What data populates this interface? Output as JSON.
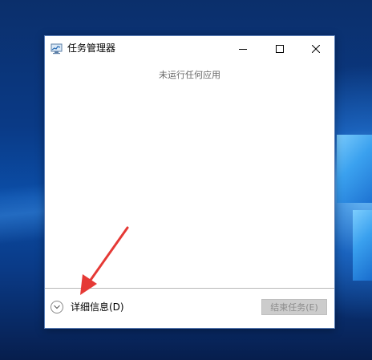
{
  "window": {
    "title": "任务管理器",
    "status_text": "未运行任何应用",
    "details_label": "详细信息(D)",
    "end_task_label": "结束任务(E)"
  },
  "icons": {
    "app": "task-manager-icon",
    "minimize": "minimize-icon",
    "maximize": "maximize-icon",
    "close": "close-icon",
    "details": "chevron-down-circle-icon"
  },
  "colors": {
    "annotation_arrow": "#e53935",
    "disabled_button_bg": "#cccccc",
    "disabled_button_text": "#8c8c8c"
  }
}
